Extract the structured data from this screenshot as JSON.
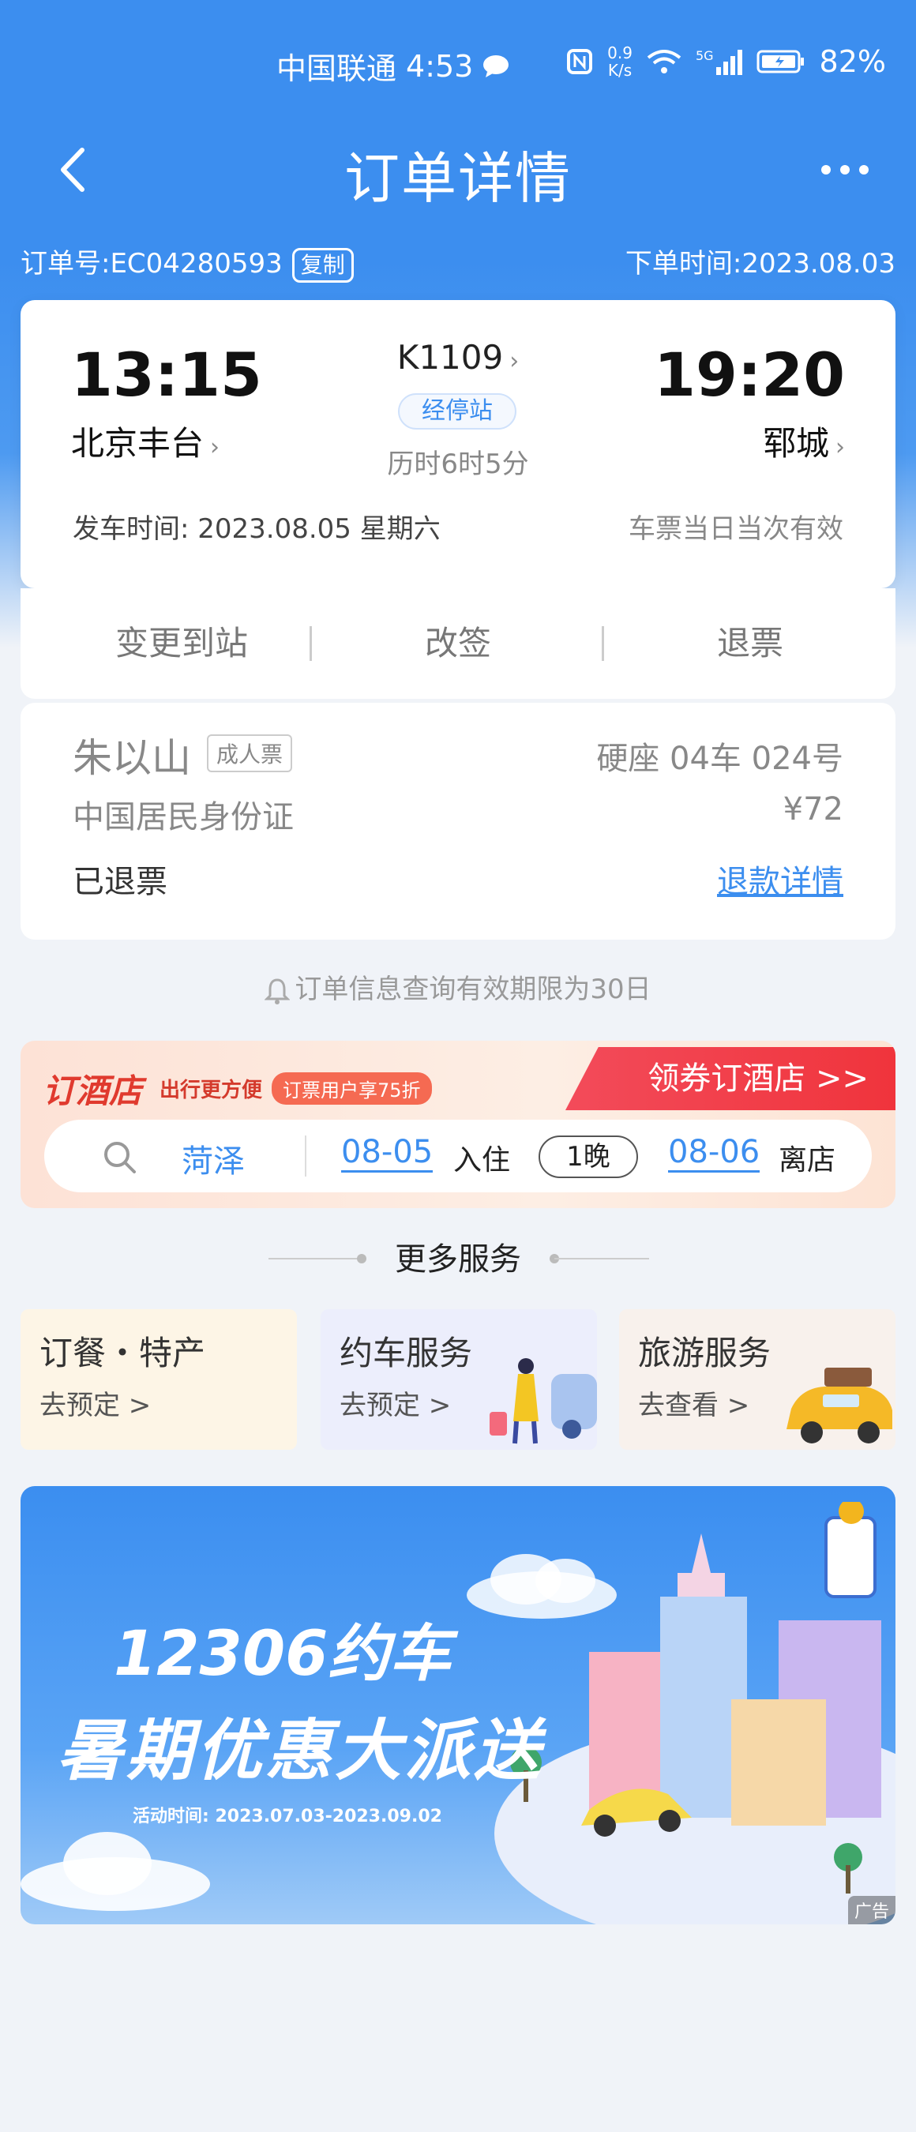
{
  "status": {
    "carrier": "中国联通",
    "time": "4:53",
    "speed_value": "0.9",
    "speed_unit": "K/s",
    "network": "5G",
    "battery": "82%"
  },
  "nav": {
    "title": "订单详情"
  },
  "order": {
    "number": "订单号:EC04280593",
    "copy_label": "复制",
    "time": "下单时间:2023.08.03"
  },
  "trip": {
    "dep_time": "13:15",
    "arr_time": "19:20",
    "dep_station": "北京丰台",
    "arr_station": "郓城",
    "train_no": "K1109",
    "stops_label": "经停站",
    "duration": "历时6时5分",
    "dep_date": "发车时间:  2023.08.05 星期六",
    "validity": "车票当日当次有效"
  },
  "actions": {
    "change_station": "变更到站",
    "rebook": "改签",
    "refund": "退票"
  },
  "passenger": {
    "name": "朱以山",
    "ticket_type": "成人票",
    "seat": "硬座 04车 024号",
    "id_type": "中国居民身份证",
    "price": "¥72",
    "status": "已退票",
    "refund_detail": "退款详情"
  },
  "notice": "订单信息查询有效期限为30日",
  "hotel": {
    "brand": "订酒店",
    "sub": "出行更方便",
    "promo": "订票用户享75折",
    "cta": "领券订酒店 >>",
    "city": "菏泽",
    "checkin_date": "08-05",
    "checkin_label": "入住",
    "nights": "1晚",
    "checkout_date": "08-06",
    "checkout_label": "离店"
  },
  "more_services": {
    "title": "更多服务",
    "items": [
      {
        "title": "订餐・特产",
        "sub": "去预定 >"
      },
      {
        "title": "约车服务",
        "sub": "去预定 >"
      },
      {
        "title": "旅游服务",
        "sub": "去查看 >"
      }
    ]
  },
  "ad": {
    "line1": "12306约车",
    "line2": "暑期优惠大派送",
    "line3": "活动时间: 2023.07.03-2023.09.02",
    "tag": "广告"
  }
}
